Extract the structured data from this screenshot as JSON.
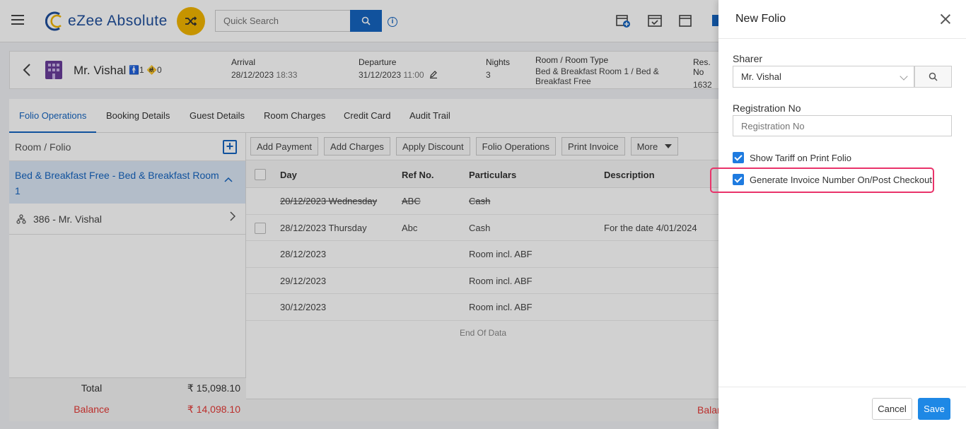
{
  "header": {
    "app_name": "eZee Absolute",
    "search_placeholder": "Quick Search"
  },
  "guest": {
    "name": "Mr. Vishal",
    "adults": "1",
    "children": "0",
    "arrival_label": "Arrival",
    "arrival_date": "28/12/2023",
    "arrival_time": "18:33",
    "departure_label": "Departure",
    "departure_date": "31/12/2023",
    "departure_time": "11:00",
    "nights_label": "Nights",
    "nights": "3",
    "room_label": "Room / Room Type",
    "room_value": "Bed & Breakfast Room 1 / Bed &",
    "room_value2": "Breakfast Free",
    "res_label": "Res. No",
    "res_value": "1632"
  },
  "tabs": [
    "Folio Operations",
    "Booking Details",
    "Guest Details",
    "Room Charges",
    "Credit Card",
    "Audit Trail"
  ],
  "left_panel": {
    "header": "Room / Folio",
    "room_line1": "Bed & Breakfast Free - Bed & Breakfast Room",
    "room_line2": "1",
    "folio": "386 - Mr. Vishal",
    "total_label": "Total",
    "total_value": "₹ 15,098.10",
    "balance_label": "Balance",
    "balance_value": "₹ 14,098.10"
  },
  "toolbar": [
    "Add Payment",
    "Add Charges",
    "Apply Discount",
    "Folio Operations",
    "Print Invoice",
    "More"
  ],
  "grid": {
    "columns": [
      "Day",
      "Ref No.",
      "Particulars",
      "Description"
    ],
    "rows": [
      {
        "day": "20/12/2023 Wednesday",
        "ref": "ABC",
        "particulars": "Cash",
        "description": ""
      },
      {
        "day": "28/12/2023 Thursday",
        "ref": "Abc",
        "particulars": "Cash",
        "description": "For the date 4/01/2024"
      },
      {
        "day": "28/12/2023",
        "ref": "",
        "particulars": "Room incl. ABF",
        "description": ""
      },
      {
        "day": "29/12/2023",
        "ref": "",
        "particulars": "Room incl. ABF",
        "description": ""
      },
      {
        "day": "30/12/2023",
        "ref": "",
        "particulars": "Room incl. ABF",
        "description": ""
      }
    ],
    "end_text": "End Of Data",
    "footer_balance": "Balan"
  },
  "drawer": {
    "title": "New Folio",
    "sharer_label": "Sharer",
    "sharer_value": "Mr. Vishal",
    "reg_label": "Registration No",
    "reg_placeholder": "Registration No",
    "show_tariff_label": "Show Tariff on Print Folio",
    "generate_invoice_label": "Generate Invoice Number On/Post Checkout",
    "cancel_label": "Cancel",
    "save_label": "Save"
  },
  "colors": {
    "accent": "#1565c0",
    "save": "#1e88e5",
    "highlight": "#e9336a",
    "balance": "#e53935"
  }
}
